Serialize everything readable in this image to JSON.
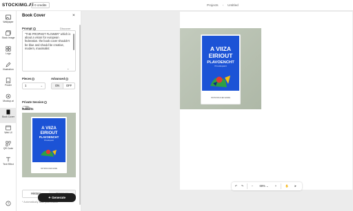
{
  "app": {
    "logo": "STOCKIMG.AI",
    "credits": "0 credits",
    "breadcrumb": [
      "Projects",
      "Untitled"
    ]
  },
  "rail": {
    "items": [
      {
        "label": "Wallpaper",
        "icon": "image-icon"
      },
      {
        "label": "Stock Image",
        "icon": "photo-stack-icon"
      },
      {
        "label": "Logo",
        "icon": "grid-icon"
      },
      {
        "label": "Illustration",
        "icon": "pen-nib-icon"
      },
      {
        "label": "Poster",
        "icon": "poster-icon"
      },
      {
        "label": "Mockup.ai",
        "icon": "mockup-icon"
      },
      {
        "label": "Book Cover",
        "icon": "book-icon"
      },
      {
        "label": "Web UI",
        "icon": "web-layout-icon"
      },
      {
        "label": "QR Code",
        "icon": "qr-code-icon"
      },
      {
        "label": "Text Effect",
        "icon": "text-icon"
      }
    ],
    "active": "Book Cover"
  },
  "panel": {
    "title": "Book Cover",
    "prompt_label": "Prompt",
    "discover_link": "Discover",
    "prompt_text": "\"THE PROPHET FLOWER\" which is about a vision for european federation. the book cover shouldn't be blue and should be creative, modern, maximalist",
    "pieces_label": "Pieces",
    "pieces_value": "1",
    "advanced_label": "Advanced",
    "advanced_on": "ON",
    "advanced_off": "OFF",
    "private_label": "Private Session",
    "private_on": false,
    "results_label": "Results",
    "tabs": [
      "History",
      "Discover"
    ],
    "footer_text": "* Automatically save your results",
    "generate_label": "Generate"
  },
  "book": {
    "title_line1": "A VIIZA",
    "title_line2": "EIRIOUT",
    "title_line3": "PLAVOENCHT",
    "subtitle": "Prouduquant",
    "footer": "NSTRODUCED ENRE",
    "cover_color": "#1c53d6",
    "background_color": "#b9c2b2"
  },
  "zoom": {
    "level": "69%",
    "minus": "−",
    "plus": "+"
  }
}
